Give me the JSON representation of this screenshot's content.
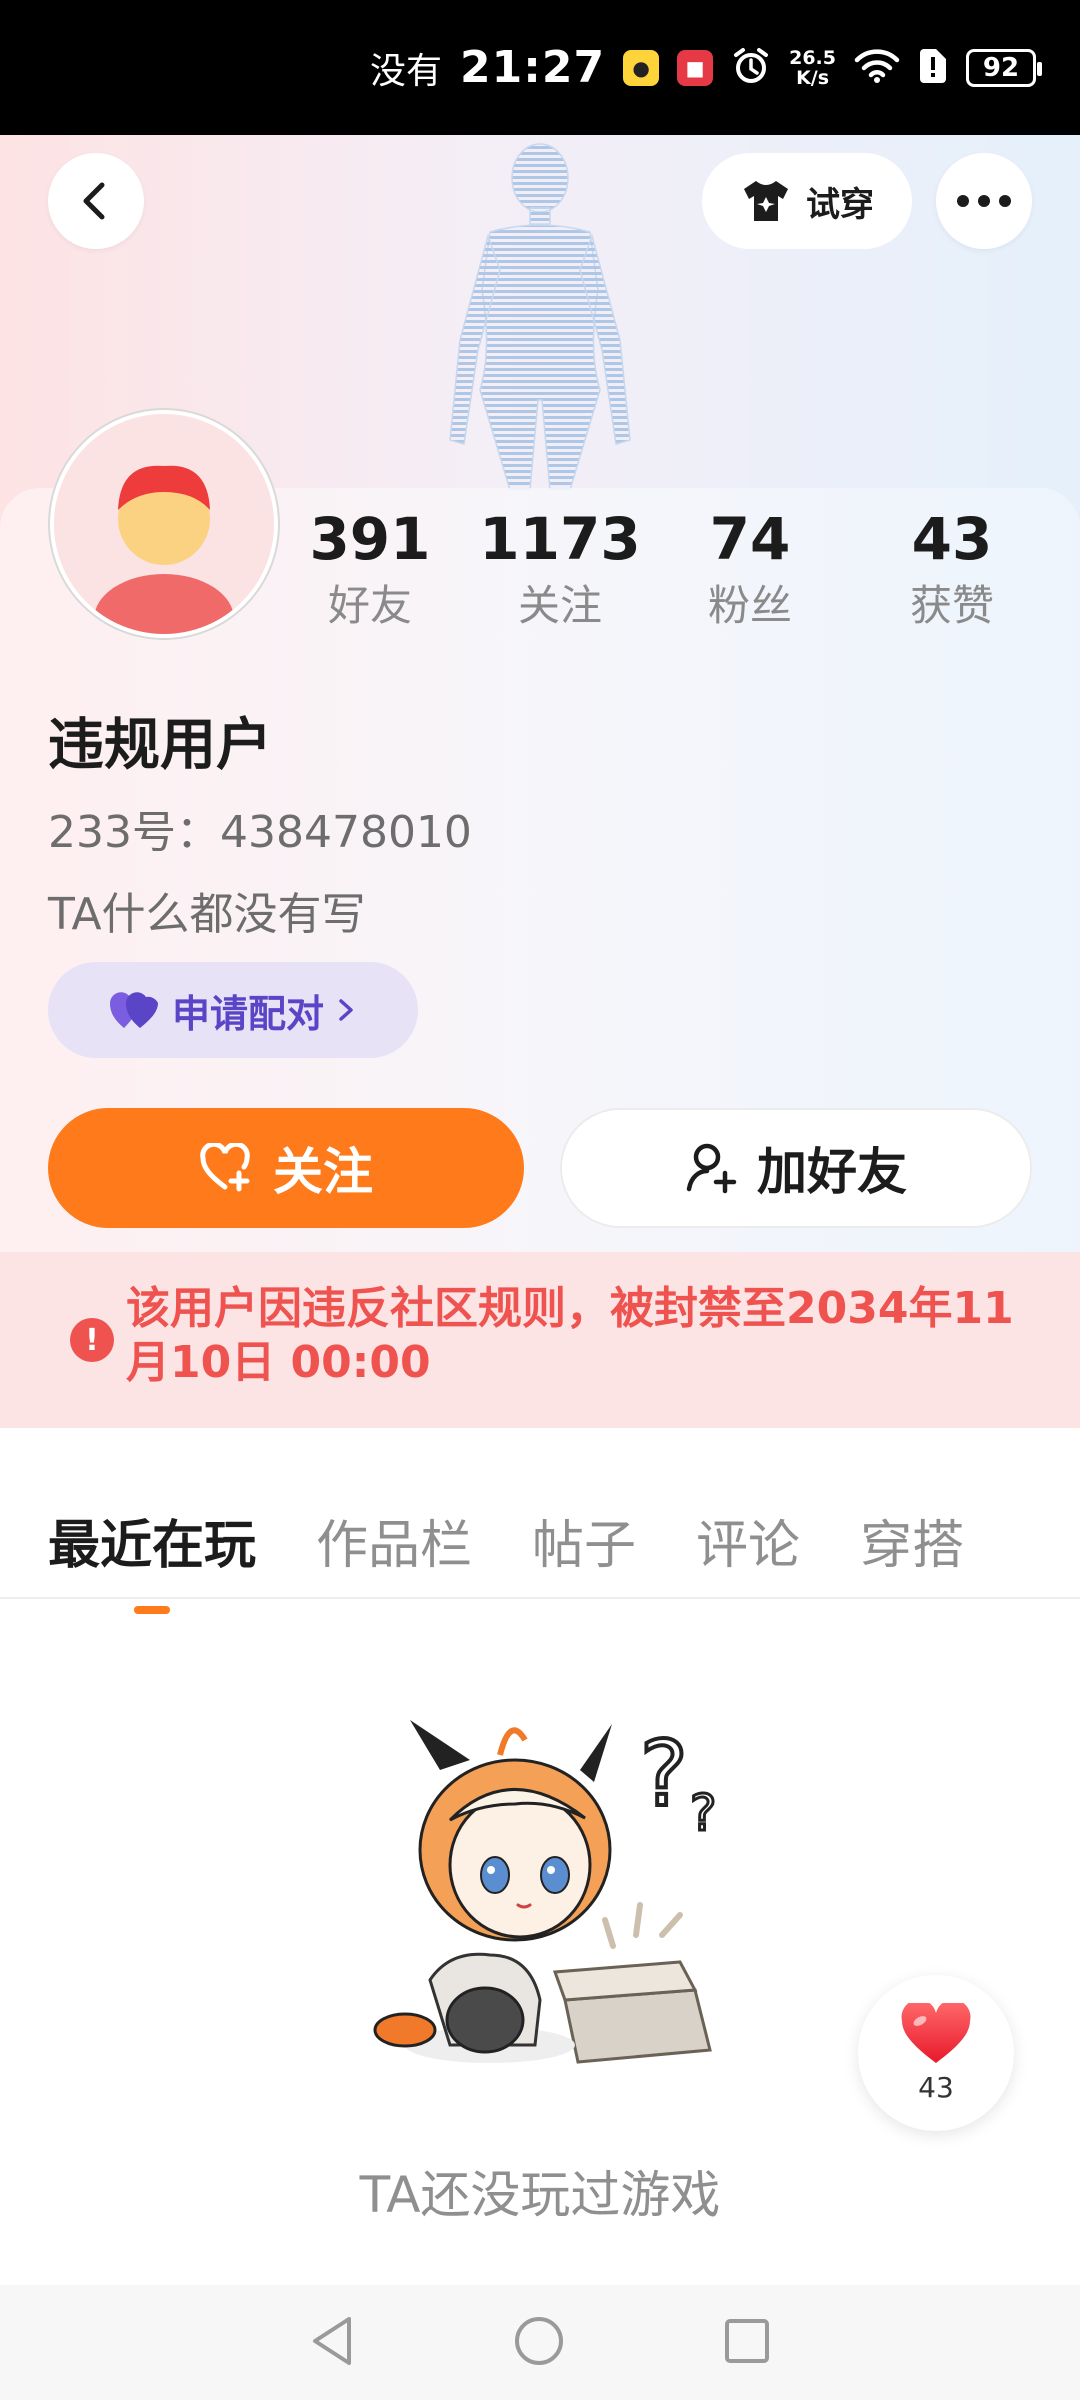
{
  "status_bar": {
    "carrier": "没有",
    "time": "21:27",
    "net_speed_value": "26.5",
    "net_speed_unit": "K/s",
    "battery": "92",
    "app_icons": [
      "yellow-app-icon",
      "red-app-icon"
    ],
    "icons": [
      "alarm-icon",
      "wifi-icon",
      "sim-alert-icon",
      "battery-icon"
    ]
  },
  "header": {
    "back_icon": "back-arrow-icon",
    "try_on_label": "试穿",
    "try_on_icon": "tshirt-icon",
    "more_icon": "more-dots-icon"
  },
  "profile": {
    "username": "违规用户",
    "id_text": "233号：438478010",
    "bio": "TA什么都没有写",
    "pair_label": "申请配对",
    "pair_icon": "heart-pair-icon"
  },
  "stats": [
    {
      "value": "391",
      "label": "好友"
    },
    {
      "value": "1173",
      "label": "关注"
    },
    {
      "value": "74",
      "label": "粉丝"
    },
    {
      "value": "43",
      "label": "获赞"
    }
  ],
  "actions": {
    "follow_label": "关注",
    "add_friend_label": "加好友"
  },
  "ban_notice": {
    "text": "该用户因违反社区规则，被封禁至2034年11月10日 00:00"
  },
  "tabs": [
    {
      "label": "最近在玩",
      "active": true
    },
    {
      "label": "作品栏",
      "active": false
    },
    {
      "label": "帖子",
      "active": false
    },
    {
      "label": "评论",
      "active": false
    },
    {
      "label": "穿搭",
      "active": false
    }
  ],
  "empty_state": {
    "text": "TA还没玩过游戏"
  },
  "like_float": {
    "count": "43"
  },
  "colors": {
    "accent": "#ff7a1a",
    "ban_red": "#ef5350",
    "pair_purple": "#5b45c7"
  }
}
